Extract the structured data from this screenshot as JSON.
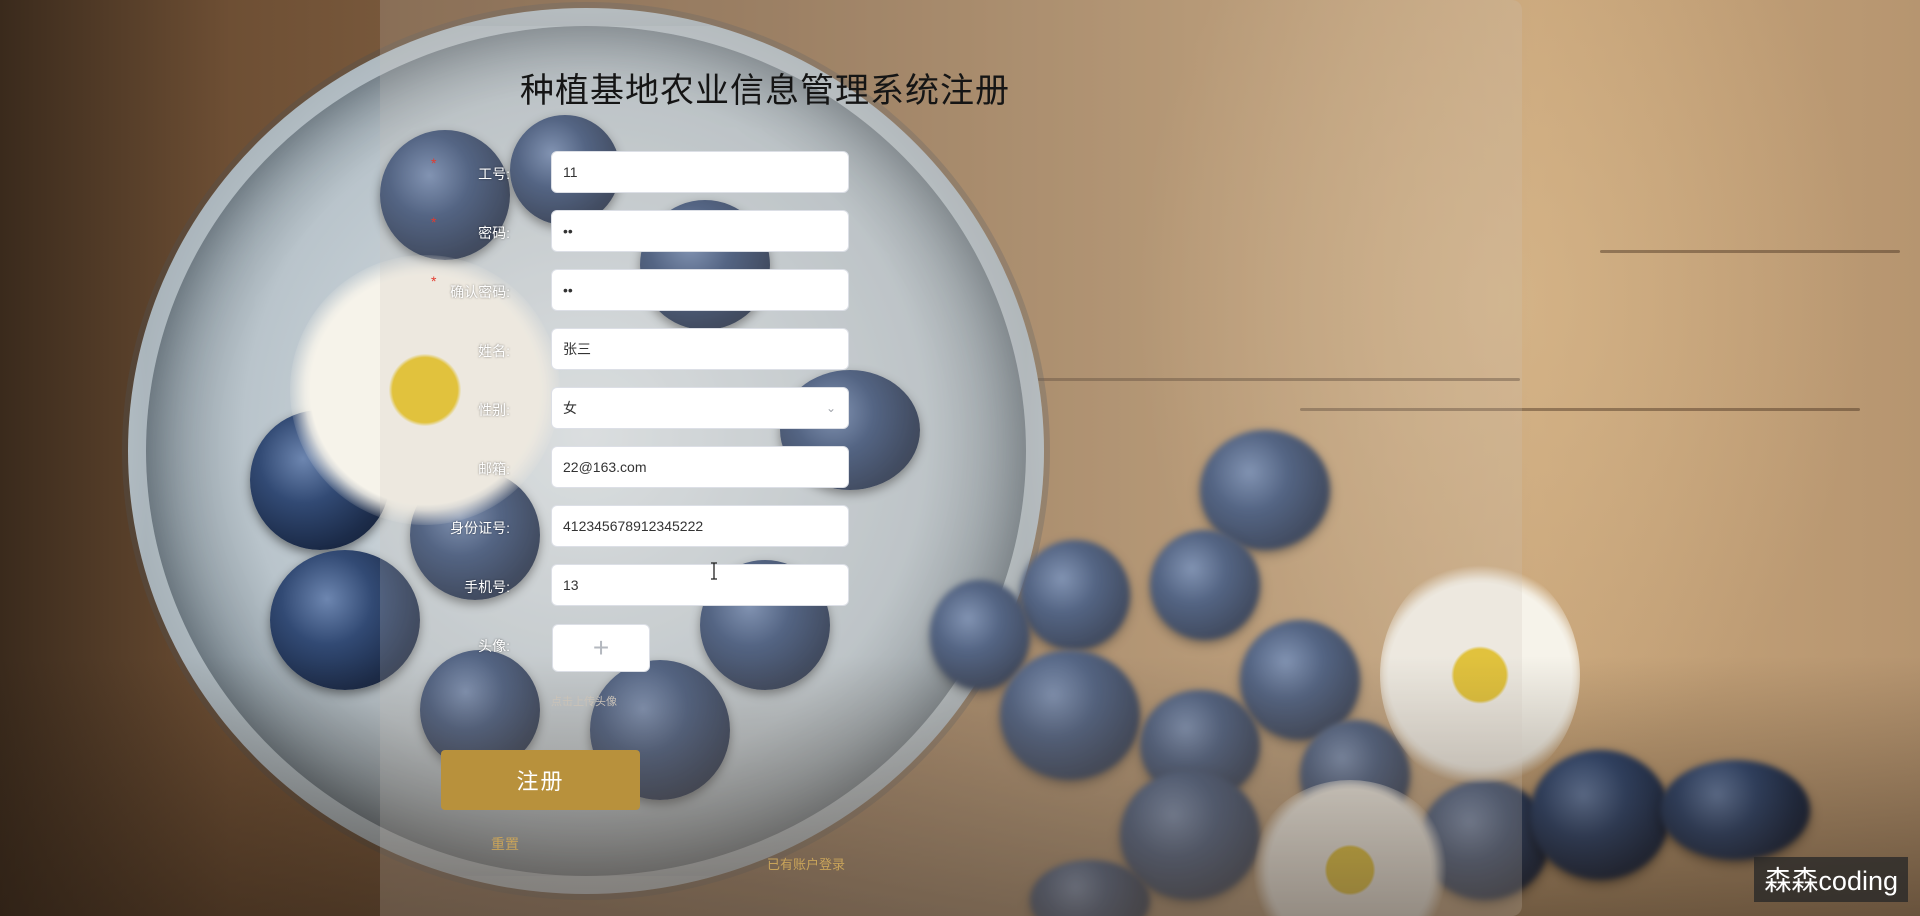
{
  "page": {
    "title": "种植基地农业信息管理系统注册",
    "accent_color": "#b8913c",
    "required_mark": "*",
    "watermark": "森森coding"
  },
  "form": {
    "fields": [
      {
        "key": "job_no",
        "label": "工号:",
        "value": "11",
        "required": true
      },
      {
        "key": "password",
        "label": "密码:",
        "value": "••",
        "required": true
      },
      {
        "key": "confirm_password",
        "label": "确认密码:",
        "value": "••",
        "required": true
      },
      {
        "key": "name",
        "label": "姓名:",
        "value": "张三",
        "required": false
      },
      {
        "key": "gender",
        "label": "性别:",
        "value": "女",
        "required": false,
        "icon": "chevron-down-icon"
      },
      {
        "key": "email",
        "label": "邮箱:",
        "value": "22@163.com",
        "required": false
      },
      {
        "key": "id_card",
        "label": "身份证号:",
        "value": "412345678912345222",
        "required": false
      },
      {
        "key": "phone",
        "label": "手机号:",
        "value": "13",
        "required": false
      }
    ],
    "avatar": {
      "label": "头像:",
      "plus": "+",
      "tip": "点击上传头像"
    },
    "buttons": {
      "register": "注册",
      "reset": "重置",
      "login_link": "已有账户登录"
    }
  }
}
